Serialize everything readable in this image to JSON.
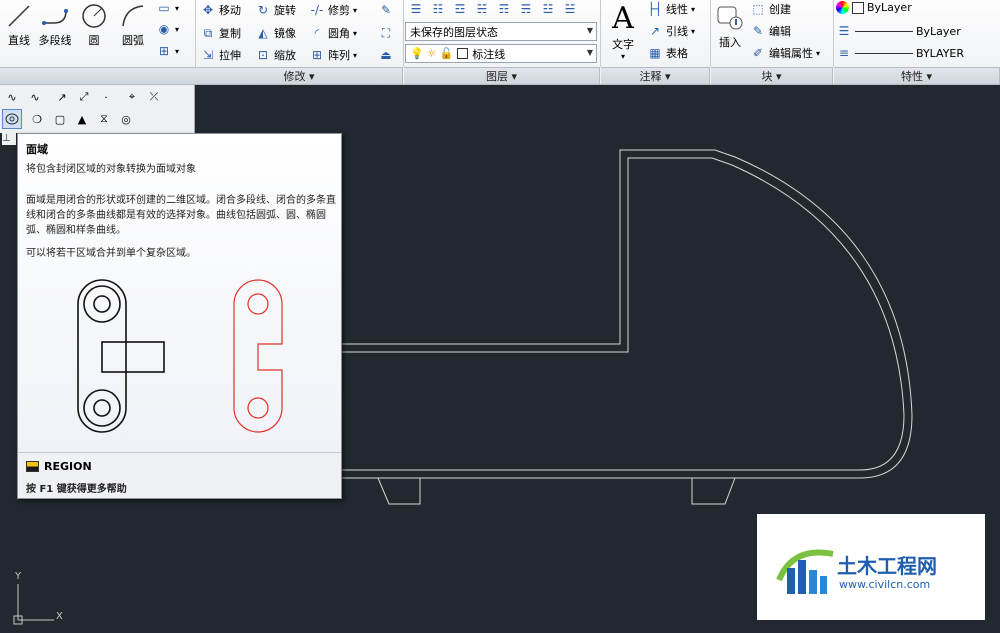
{
  "draw_panel": {
    "line": "直线",
    "polyline": "多段线",
    "circle": "圆",
    "arc": "圆弧"
  },
  "modify_panel": {
    "title": "修改",
    "move": "移动",
    "rotate": "旋转",
    "trim": "修剪",
    "copy": "复制",
    "mirror": "镜像",
    "fillet": "圆角",
    "stretch": "拉伸",
    "scale": "缩放",
    "array": "阵列"
  },
  "layers_panel": {
    "title": "图层",
    "state_combo": "未保存的图层状态",
    "layer_combo": "标注线"
  },
  "annotation_panel": {
    "title": "注释",
    "text": "文字",
    "dimension": "线性",
    "leader": "引线",
    "table": "表格"
  },
  "block_panel": {
    "title": "块",
    "insert": "插入",
    "create": "创建",
    "edit": "编辑",
    "edit_attributes": "编辑属性"
  },
  "properties_panel": {
    "title": "特性",
    "color": "ByLayer",
    "linetype": "ByLayer",
    "lineweight": "BYLAYER"
  },
  "tooltip": {
    "title": "面域",
    "line1": "将包含封闭区域的对象转换为面域对象",
    "line2": "面域是用闭合的形状或环创建的二维区域。闭合多段线、闭合的多条直线和闭合的多条曲线都是有效的选择对象。曲线包括圆弧、圆、椭圆弧、椭圆和样条曲线。",
    "line3": "可以将若干区域合并到单个复杂区域。",
    "command": "REGION",
    "help": "按 F1 键获得更多帮助"
  },
  "ucs": {
    "x": "X",
    "y": "Y"
  },
  "watermark": {
    "name": "土木工程网",
    "url": "www.civilcn.com"
  },
  "colors": {
    "canvas": "#212830",
    "region_red": "#e0302a",
    "outline": "#d8d8d8"
  }
}
